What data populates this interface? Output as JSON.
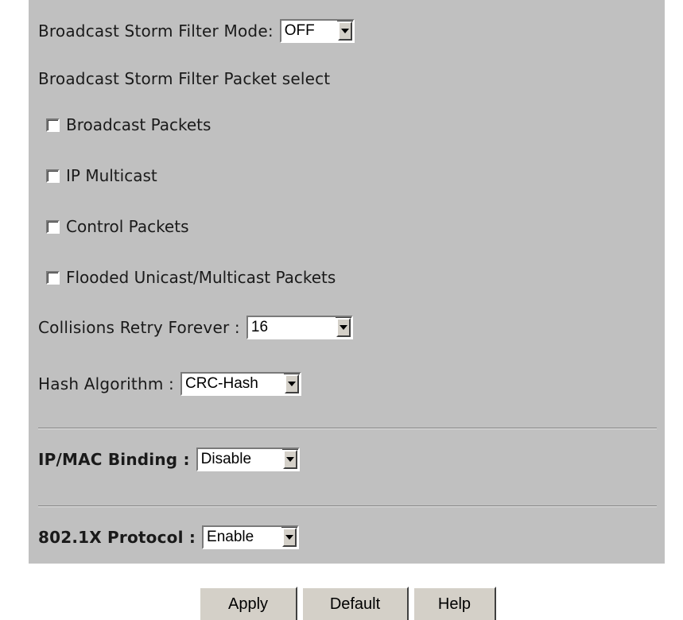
{
  "storm_filter": {
    "mode_label": "Broadcast Storm Filter Mode:",
    "mode_value": "OFF",
    "packet_select_label": "Broadcast Storm Filter Packet select",
    "checkboxes": [
      {
        "label": "Broadcast Packets",
        "checked": false
      },
      {
        "label": "IP Multicast",
        "checked": false
      },
      {
        "label": "Control Packets",
        "checked": false
      },
      {
        "label": "Flooded Unicast/Multicast Packets",
        "checked": false
      }
    ]
  },
  "collisions": {
    "label": "Collisions Retry Forever :",
    "value": "16"
  },
  "hash": {
    "label": "Hash Algorithm :",
    "value": "CRC-Hash"
  },
  "ipmac": {
    "label": "IP/MAC Binding :",
    "value": "Disable"
  },
  "dot1x": {
    "label": "802.1X Protocol :",
    "value": "Enable"
  },
  "buttons": {
    "apply": "Apply",
    "default": "Default",
    "help": "Help"
  },
  "colors": {
    "panel_bg": "#c0c0c0",
    "button_face": "#d4d0c8"
  }
}
